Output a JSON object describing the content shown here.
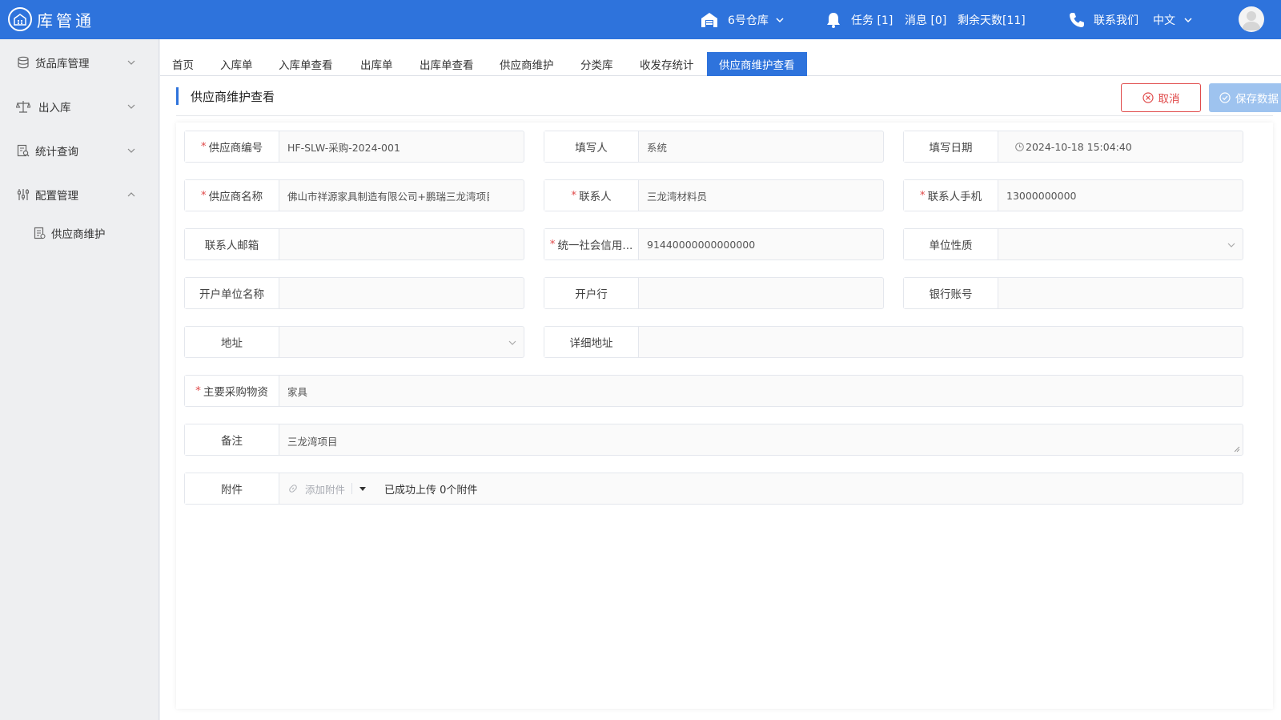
{
  "header": {
    "brand": "库管通",
    "warehouse": "6号仓库",
    "tasks": "任务 [1]",
    "messages": "消息 [0]",
    "days_left": "剩余天数[11]",
    "contact": "联系我们",
    "language": "中文"
  },
  "sidebar": {
    "items": [
      {
        "label": "货品库管理",
        "icon": "database-icon"
      },
      {
        "label": "出入库",
        "icon": "scale-icon"
      },
      {
        "label": "统计查询",
        "icon": "report-search-icon"
      },
      {
        "label": "配置管理",
        "icon": "sliders-icon"
      }
    ],
    "sub_items": [
      {
        "label": "供应商维护",
        "icon": "document-icon"
      }
    ]
  },
  "tabs": [
    {
      "label": "首页"
    },
    {
      "label": "入库单"
    },
    {
      "label": "入库单查看"
    },
    {
      "label": "出库单"
    },
    {
      "label": "出库单查看"
    },
    {
      "label": "供应商维护"
    },
    {
      "label": "分类库"
    },
    {
      "label": "收发存统计"
    },
    {
      "label": "供应商维护查看"
    }
  ],
  "page": {
    "title": "供应商维护查看",
    "cancel_label": "取消",
    "save_label": "保存数据"
  },
  "form": {
    "supplier_code": {
      "label": "供应商编号",
      "value": "HF-SLW-采购-2024-001"
    },
    "filled_by": {
      "label": "填写人",
      "value": "系统"
    },
    "fill_date": {
      "label": "填写日期",
      "value": "2024-10-18 15:04:40"
    },
    "supplier_name": {
      "label": "供应商名称",
      "value": "佛山市祥源家具制造有限公司+鹏瑞三龙湾项目"
    },
    "contact_person": {
      "label": "联系人",
      "value": "三龙湾材料员"
    },
    "contact_phone": {
      "label": "联系人手机",
      "value": "13000000000"
    },
    "contact_email": {
      "label": "联系人邮箱",
      "value": ""
    },
    "credit_code": {
      "label": "统一社会信用...",
      "value": "91440000000000000"
    },
    "unit_type": {
      "label": "单位性质",
      "value": ""
    },
    "account_name": {
      "label": "开户单位名称",
      "value": ""
    },
    "bank": {
      "label": "开户行",
      "value": ""
    },
    "bank_account": {
      "label": "银行账号",
      "value": ""
    },
    "address": {
      "label": "地址",
      "value": ""
    },
    "detail_address": {
      "label": "详细地址",
      "value": ""
    },
    "main_materials": {
      "label": "主要采购物资",
      "value": "家具"
    },
    "remarks": {
      "label": "备注",
      "value": "三龙湾项目"
    },
    "attachments": {
      "label": "附件",
      "add_label": "添加附件",
      "status": "已成功上传 0个附件"
    }
  }
}
